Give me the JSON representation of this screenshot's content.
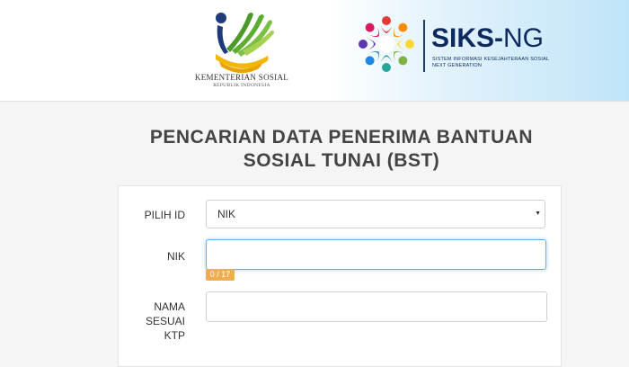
{
  "header": {
    "kemensos": {
      "name": "KEMENTERIAN SOSIAL",
      "subtitle": "REPUBLIK INDONESIA",
      "logo_icon": "kemensos-wheat-logo-icon"
    },
    "siks": {
      "title_main": "SIKS-",
      "title_suffix": "NG",
      "description": "SISTEM INFORMASI KESEJAHTERAAN SOSIAL",
      "description_line2": "NEXT GENERATION",
      "emblem_icon": "siks-people-circle-emblem-icon"
    }
  },
  "page": {
    "title_line1": "PENCARIAN DATA PENERIMA BANTUAN",
    "title_line2": "SOSIAL TUNAI (BST)"
  },
  "form": {
    "pilih_id_label": "PILIH ID",
    "pilih_id_value": "NIK",
    "pilih_id_options": [
      "NIK"
    ],
    "nik_label": "NIK",
    "nik_value": "",
    "nik_counter": "0 / 17",
    "nama_label_line1": "NAMA",
    "nama_label_line2": "SESUAI",
    "nama_label_line3": "KTP",
    "nama_value": ""
  },
  "colors": {
    "siks_navy": "#0d2a5e",
    "title_gray": "#444444",
    "counter_badge": "#f0ad4e",
    "focus_border": "#66afe9",
    "kemensos_gold": "#f2b705",
    "kemensos_green": "#4c9a2a",
    "kemensos_navy": "#1f3a7a"
  }
}
